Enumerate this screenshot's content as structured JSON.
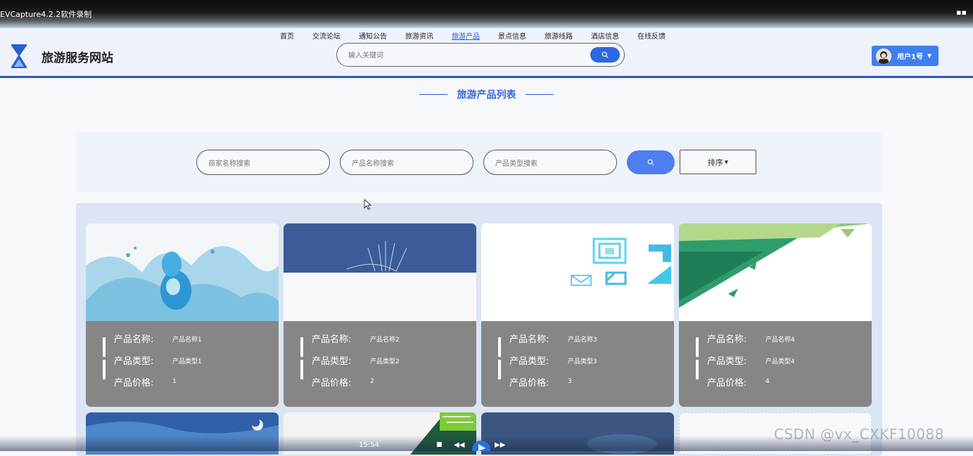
{
  "capture": {
    "title": "EVCapture4.2.2软件录制"
  },
  "nav": {
    "items": [
      {
        "label": "首页"
      },
      {
        "label": "交流论坛"
      },
      {
        "label": "通知公告"
      },
      {
        "label": "旅游资讯"
      },
      {
        "label": "旅游产品",
        "active": true
      },
      {
        "label": "景点信息"
      },
      {
        "label": "旅游线路"
      },
      {
        "label": "酒店信息"
      },
      {
        "label": "在线反馈"
      }
    ]
  },
  "header": {
    "site_title": "旅游服务网站",
    "search_placeholder": "输入关键词",
    "user_label": "用户1号"
  },
  "section": {
    "title": "旅游产品列表"
  },
  "filters": {
    "merchant_placeholder": "商家名称搜索",
    "product_placeholder": "产品名称搜索",
    "type_placeholder": "产品类型搜索",
    "sort_label": "排序"
  },
  "products": [
    {
      "name_label": "产品名称:",
      "name": "产品名称1",
      "type_label": "产品类型:",
      "type": "产品类型1",
      "price_label": "产品价格:",
      "price": "1"
    },
    {
      "name_label": "产品名称:",
      "name": "产品名称2",
      "type_label": "产品类型:",
      "type": "产品类型2",
      "price_label": "产品价格:",
      "price": "2"
    },
    {
      "name_label": "产品名称:",
      "name": "产品名称3",
      "type_label": "产品类型:",
      "type": "产品类型3",
      "price_label": "产品价格:",
      "price": "3"
    },
    {
      "name_label": "产品名称:",
      "name": "产品名称4",
      "type_label": "产品类型:",
      "type": "产品类型4",
      "price_label": "产品价格:",
      "price": "4"
    }
  ],
  "player": {
    "time": "15:54"
  },
  "watermark": "CSDN @vx_CXKF10088",
  "colors": {
    "accent": "#2d57d6",
    "button": "#4f7ef0",
    "card_info": "#868686"
  }
}
